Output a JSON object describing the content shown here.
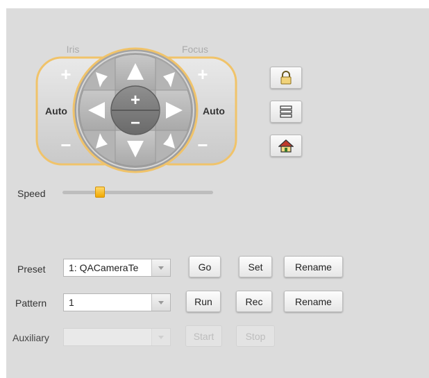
{
  "ptz": {
    "iris_label": "Iris",
    "focus_label": "Focus",
    "iris_auto": "Auto",
    "focus_auto": "Auto",
    "zoom_in_symbol": "+",
    "zoom_out_symbol": "−"
  },
  "side_buttons": [
    {
      "name": "lock",
      "icon": "lock-icon"
    },
    {
      "name": "menu",
      "icon": "list-icon"
    },
    {
      "name": "home",
      "icon": "home-icon"
    }
  ],
  "speed": {
    "label": "Speed",
    "value": 0.25
  },
  "preset": {
    "label": "Preset",
    "selected": "1: QACameraTe",
    "go": "Go",
    "set": "Set",
    "rename": "Rename"
  },
  "pattern": {
    "label": "Pattern",
    "selected": "1",
    "run": "Run",
    "rec": "Rec",
    "rename": "Rename"
  },
  "auxiliary": {
    "label": "Auxiliary",
    "selected": "",
    "start": "Start",
    "stop": "Stop",
    "enabled": false
  },
  "colors": {
    "panel_bg": "#dcdcdc",
    "accent_ring": "#f0c36a",
    "slider_thumb": "#f5b800"
  }
}
